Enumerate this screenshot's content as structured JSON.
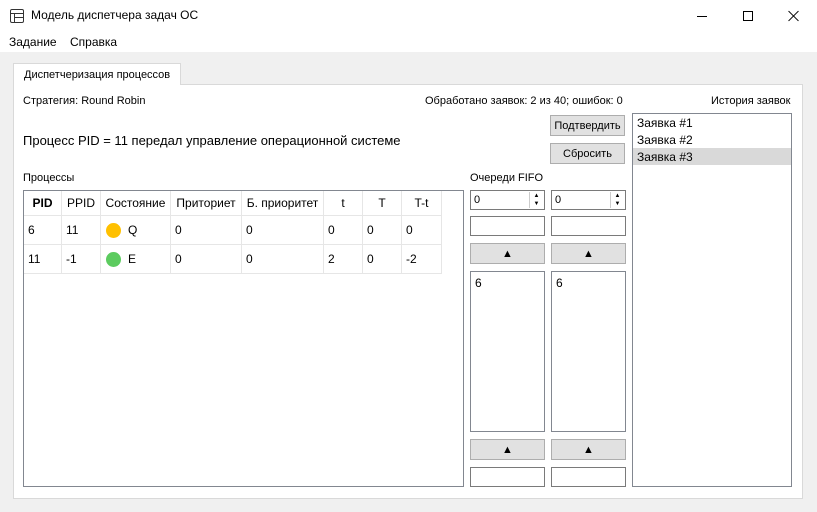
{
  "window": {
    "title": "Модель диспетчера задач ОС"
  },
  "menu": [
    "Задание",
    "Справка"
  ],
  "tab": {
    "label": "Диспетчеризация процессов"
  },
  "strategy": "Стратегия: Round Robin",
  "stats": "Обработано заявок: 2 из 40; ошибок: 0",
  "history_label": "История заявок",
  "message": "Процесс PID = 11 передал управление операционной системе",
  "buttons": {
    "confirm": "Подтвердить",
    "reset": "Сбросить"
  },
  "processes": {
    "label": "Процессы",
    "columns": [
      "PID",
      "PPID",
      "Состояние",
      "Приториет",
      "Б. приоритет",
      "t",
      "T",
      "T-t"
    ],
    "rows": [
      {
        "pid": "6",
        "ppid": "11",
        "state": "Q",
        "state_color": "#ffc000",
        "priority": "0",
        "base_priority": "0",
        "t": "0",
        "T": "0",
        "Tt": "0"
      },
      {
        "pid": "11",
        "ppid": "-1",
        "state": "E",
        "state_color": "#5ccb5f",
        "priority": "0",
        "base_priority": "0",
        "t": "2",
        "T": "0",
        "Tt": "-2"
      }
    ]
  },
  "fifo": {
    "label": "Очереди FIFO",
    "queues": [
      {
        "spin_value": "0",
        "arrow_icon": "arrow-up-icon",
        "items": [
          "6"
        ]
      },
      {
        "spin_value": "0",
        "arrow_icon": "arrow-up-icon",
        "items": [
          "6"
        ]
      }
    ],
    "arrow_glyph": "▲"
  },
  "history": {
    "items": [
      "Заявка #1",
      "Заявка #2",
      "Заявка #3"
    ],
    "selected_index": 2
  }
}
